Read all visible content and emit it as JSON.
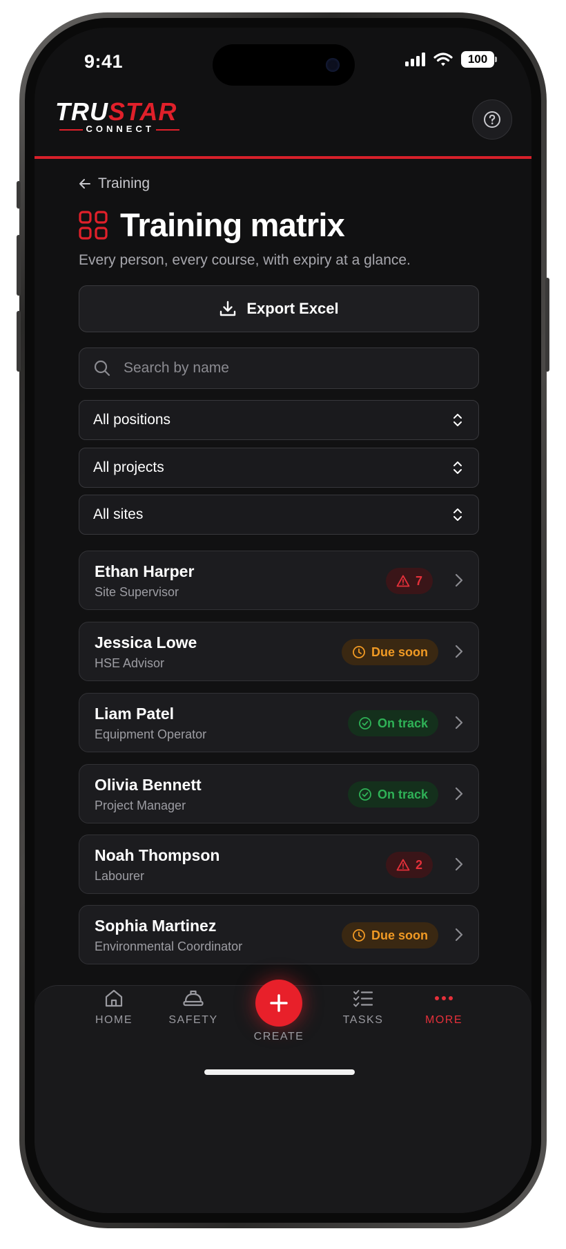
{
  "status_bar": {
    "time": "9:41",
    "battery": "100"
  },
  "header": {
    "logo": {
      "part_white": "TRU",
      "part_red": "STAR",
      "sub": "CONNECT"
    },
    "help_icon": "help-circle-icon"
  },
  "breadcrumb": {
    "label": "Training"
  },
  "page": {
    "title": "Training matrix",
    "subtitle": "Every person, every course, with expiry at a glance.",
    "export_label": "Export Excel"
  },
  "search": {
    "placeholder": "Search by name",
    "value": ""
  },
  "filters": [
    {
      "label": "All positions"
    },
    {
      "label": "All projects"
    },
    {
      "label": "All sites"
    }
  ],
  "people": [
    {
      "name": "Ethan Harper",
      "role": "Site Supervisor",
      "badge": {
        "type": "alert",
        "text": "7"
      }
    },
    {
      "name": "Jessica Lowe",
      "role": "HSE Advisor",
      "badge": {
        "type": "due",
        "text": "Due soon"
      }
    },
    {
      "name": "Liam Patel",
      "role": "Equipment Operator",
      "badge": {
        "type": "ok",
        "text": "On track"
      }
    },
    {
      "name": "Olivia Bennett",
      "role": "Project Manager",
      "badge": {
        "type": "ok",
        "text": "On track"
      }
    },
    {
      "name": "Noah Thompson",
      "role": "Labourer",
      "badge": {
        "type": "alert",
        "text": "2"
      }
    },
    {
      "name": "Sophia Martinez",
      "role": "Environmental Coordinator",
      "badge": {
        "type": "due",
        "text": "Due soon"
      }
    }
  ],
  "tabbar": {
    "home": "HOME",
    "safety": "SAFETY",
    "create": "CREATE",
    "tasks": "TASKS",
    "more": "MORE",
    "active": "more"
  },
  "colors": {
    "accent": "#e0202a",
    "alert": "#e5303a",
    "due": "#f19a24",
    "ok": "#2fb257",
    "background": "#111112"
  }
}
